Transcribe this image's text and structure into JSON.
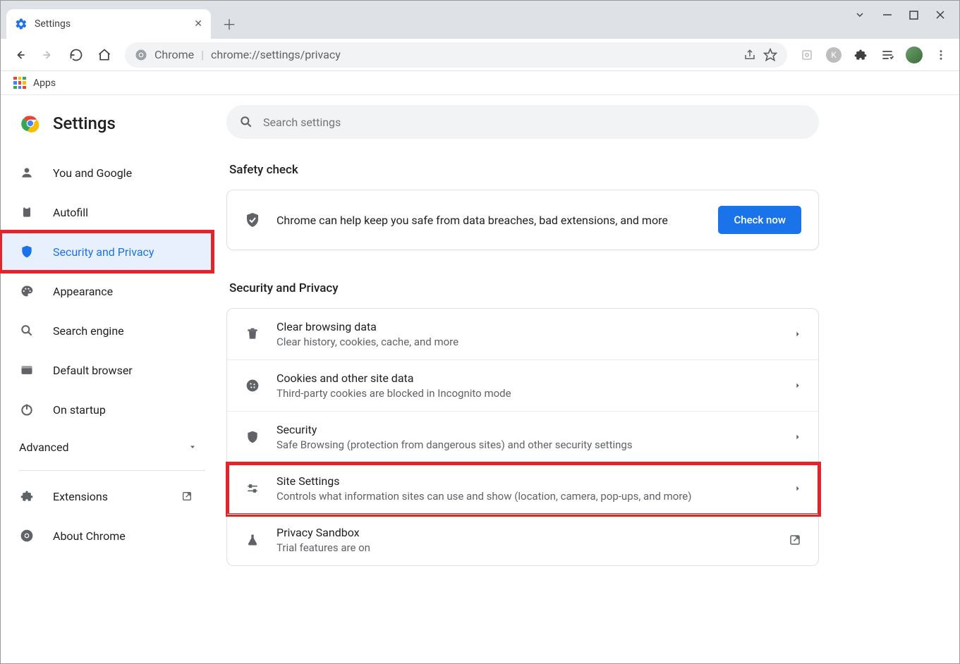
{
  "tab": {
    "title": "Settings"
  },
  "omnibox": {
    "label": "Chrome",
    "url": "chrome://settings/privacy"
  },
  "bookmarks": {
    "apps": "Apps"
  },
  "brand": "Settings",
  "search": {
    "placeholder": "Search settings"
  },
  "sidebar": {
    "items": [
      {
        "label": "You and Google"
      },
      {
        "label": "Autofill"
      },
      {
        "label": "Security and Privacy"
      },
      {
        "label": "Appearance"
      },
      {
        "label": "Search engine"
      },
      {
        "label": "Default browser"
      },
      {
        "label": "On startup"
      }
    ],
    "advanced": "Advanced",
    "extensions": "Extensions",
    "about": "About Chrome"
  },
  "safety": {
    "heading": "Safety check",
    "text": "Chrome can help keep you safe from data breaches, bad extensions, and more",
    "button": "Check now"
  },
  "privacy": {
    "heading": "Security and Privacy",
    "rows": [
      {
        "title": "Clear browsing data",
        "sub": "Clear history, cookies, cache, and more"
      },
      {
        "title": "Cookies and other site data",
        "sub": "Third-party cookies are blocked in Incognito mode"
      },
      {
        "title": "Security",
        "sub": "Safe Browsing (protection from dangerous sites) and other security settings"
      },
      {
        "title": "Site Settings",
        "sub": "Controls what information sites can use and show (location, camera, pop-ups, and more)"
      },
      {
        "title": "Privacy Sandbox",
        "sub": "Trial features are on"
      }
    ]
  }
}
